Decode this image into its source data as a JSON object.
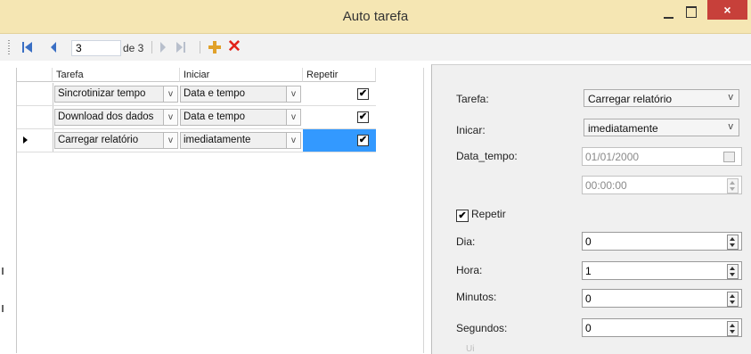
{
  "window": {
    "title": "Auto tarefa",
    "close_glyph": "×"
  },
  "navigator": {
    "position": "3",
    "of_count": "de 3",
    "delete_glyph": "✕"
  },
  "grid": {
    "columns": [
      "Tarefa",
      "Iniciar",
      "Repetir"
    ],
    "rows": [
      {
        "tarefa": "Sincrotinizar tempo",
        "iniciar": "Data e tempo",
        "repetir": true
      },
      {
        "tarefa": "Download dos dados",
        "iniciar": "Data e tempo",
        "repetir": true
      },
      {
        "tarefa": "Carregar relatório",
        "iniciar": "imediatamente",
        "repetir": true,
        "current": true
      }
    ],
    "combo_arrow": "v",
    "check_glyph": "✔",
    "selected_color": "#3399ff"
  },
  "details": {
    "tarefa_label": "Tarefa:",
    "tarefa_value": "Carregar relatório",
    "iniciar_label": "Inicar:",
    "iniciar_value": "imediatamente",
    "data_tempo_label": "Data_tempo:",
    "date_value": "01/01/2000",
    "time_value": "00:00:00",
    "repetir_label": "Repetir",
    "repetir_checked": true,
    "dia_label": "Dia:",
    "dia_value": "0",
    "hora_label": "Hora:",
    "hora_value": "1",
    "minutos_label": "Minutos:",
    "minutos_value": "0",
    "segundos_label": "Segundos:",
    "segundos_value": "0",
    "cut_label": "Ui",
    "arrow": "v"
  },
  "colors": {
    "titlebar": "#f5e6b3",
    "close_button": "#c7403a",
    "accent": "#3a6fc4",
    "panel": "#f0f0f0"
  }
}
